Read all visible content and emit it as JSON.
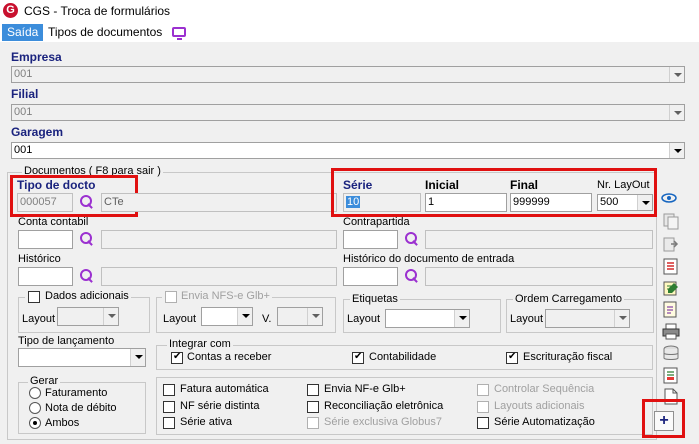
{
  "window": {
    "title": "CGS - Troca de formulários",
    "app_icon": "G"
  },
  "menu": {
    "items": [
      "Saída",
      "Tipos de documentos"
    ]
  },
  "empresa": {
    "label": "Empresa",
    "value": "001"
  },
  "filial": {
    "label": "Filial",
    "value": "001"
  },
  "garagem": {
    "label": "Garagem",
    "value": "001"
  },
  "documentos": {
    "legend": "Documentos ( F8 para sair )",
    "tipo_docto": {
      "label": "Tipo de docto",
      "code": "000057",
      "desc": "CTe"
    },
    "serie": {
      "label": "Série",
      "value": "10"
    },
    "inicial": {
      "label": "Inicial",
      "value": "1"
    },
    "final": {
      "label": "Final",
      "value": "999999"
    },
    "layout": {
      "label": "Nr. LayOut",
      "value": "500"
    },
    "conta_contabil": {
      "label": "Conta contabil"
    },
    "contrapartida": {
      "label": "Contrapartida"
    },
    "historico": {
      "label": "Histórico"
    },
    "historico_entrada": {
      "label": "Histórico do documento de entrada"
    },
    "dados_adicionais": {
      "label": "Dados adicionais",
      "layout_label": "Layout"
    },
    "envia_nfs": {
      "label": "Envia NFS-e Glb+",
      "layout_label": "Layout",
      "v_label": "V."
    },
    "etiquetas": {
      "label": "Etiquetas",
      "layout_label": "Layout"
    },
    "ordem": {
      "label": "Ordem Carregamento",
      "layout_label": "Layout"
    },
    "tipo_lancamento": {
      "label": "Tipo de lançamento"
    },
    "integrar": {
      "label": "Integrar com",
      "items": [
        "Contas a receber",
        "Contabilidade",
        "Escrituração fiscal"
      ]
    },
    "gerar": {
      "label": "Gerar",
      "options": [
        "Faturamento",
        "Nota de débito",
        "Ambos"
      ],
      "selected": "Ambos"
    },
    "checks": {
      "col1": [
        "Fatura automática",
        "NF série distinta",
        "Série ativa"
      ],
      "col2": [
        "Envia NF-e Glb+",
        "Reconciliação eletrônica",
        "Série exclusiva Globus7"
      ],
      "col3": [
        "Controlar Sequência",
        "Layouts adicionais",
        "Série Automatização"
      ]
    }
  },
  "toolbar": {
    "add_label": "+"
  },
  "colors": {
    "label_blue": "#1a237e",
    "highlight_red": "#e01010",
    "icon_purple": "#9b30d0",
    "menu_blue": "#3c8ddb"
  }
}
